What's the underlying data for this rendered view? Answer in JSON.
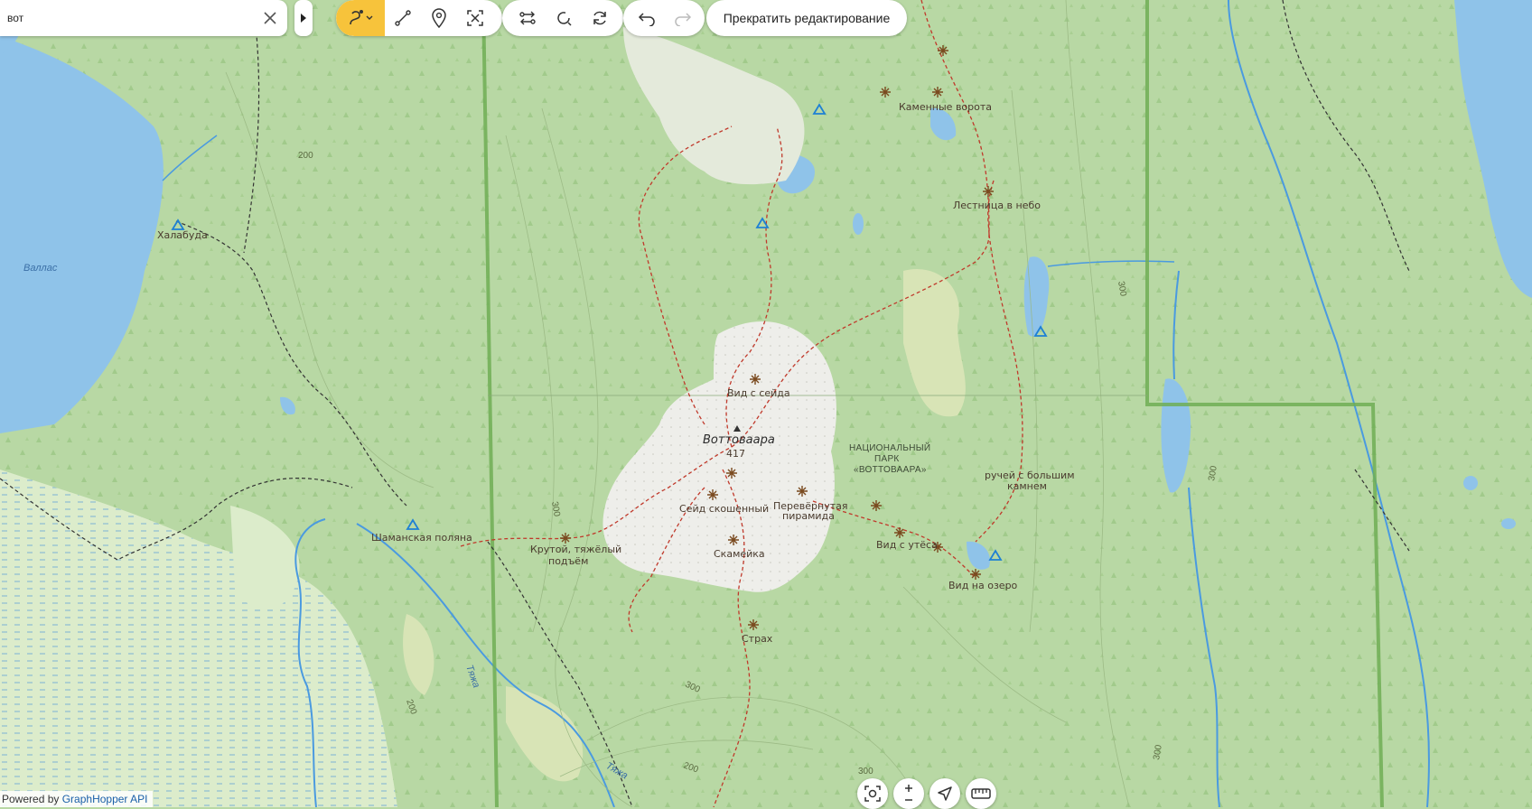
{
  "search": {
    "value": "вот"
  },
  "toolbar": {
    "stop_editing_label": "Прекратить редактирование"
  },
  "attribution": {
    "prefix": "Powered by",
    "link": "GraphHopper API"
  },
  "map_labels": {
    "khalabuda": "Халабуда",
    "vallas": "Валлас",
    "kamennye_vorota": "Каменные ворота",
    "lestnitsa": "Лестница в небо",
    "vid_s_seida": "Вид с сейда",
    "vottovaara": "Воттоваара",
    "elevation": "417",
    "park_1": "НАЦИОНАЛЬНЫЙ",
    "park_2": "ПАРК",
    "park_3": "«ВОТТОВААРА»",
    "ruchey_1": "ручей с большим",
    "ruchey_2": "камнем",
    "seid_skoshenny": "Сейд скошенный",
    "perevernutaya_1": "Перевёрнутая",
    "perevernutaya_2": "пирамида",
    "shamanskaya": "Шаманская поляна",
    "krutoy_1": "Крутой, тяжёлый",
    "krutoy_2": "подъём",
    "skameyka": "Скамейка",
    "vid_s_utesa": "Вид с утёса",
    "vid_na_ozero": "Вид на озеро",
    "strakh": "Страх",
    "river_1": "Тяжа",
    "river_2": "Тяжа",
    "contour_200a": "200",
    "contour_200b": "200",
    "contour_200c": "200",
    "contour_300a": "300",
    "contour_300b": "300",
    "contour_300c": "300",
    "contour_300d": "300",
    "contour_300e": "300",
    "contour_300f": "300"
  },
  "colors": {
    "forest": "#b8d8a4",
    "meadow": "#d4e6c0",
    "water": "#8fc3e9",
    "rock": "#eeeeea",
    "trail": "#c0392b",
    "park_border": "#6fae55",
    "accent": "#f7c33b"
  }
}
